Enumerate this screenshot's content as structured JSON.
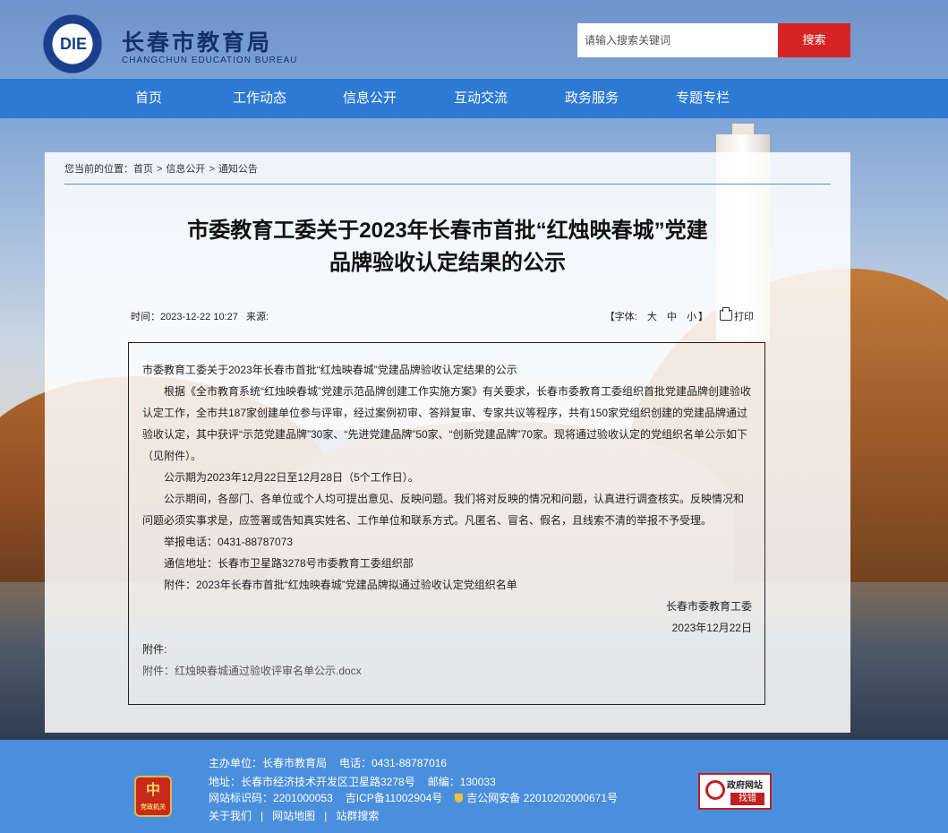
{
  "header": {
    "logo_mark": "DIE",
    "site_name": "长春市教育局",
    "site_name_en": "CHANGCHUN EDUCATION BUREAU",
    "search_placeholder": "请输入搜索关键词",
    "search_button": "搜索"
  },
  "nav": {
    "items": [
      "首页",
      "工作动态",
      "信息公开",
      "互动交流",
      "政务服务",
      "专题专栏"
    ]
  },
  "breadcrumb": {
    "prefix": "您当前的位置：",
    "items": [
      "首页",
      "信息公开",
      "通知公告"
    ],
    "separator": ">"
  },
  "article": {
    "title_line1": "市委教育工委关于2023年长春市首批“红烛映春城”党建",
    "title_line2": "品牌验收认定结果的公示",
    "time_label": "时间：",
    "time": "2023-12-22 10:27",
    "source_label": "来源:",
    "font_label": "【字体:",
    "font_large": "大",
    "font_medium": "中",
    "font_small": "小",
    "font_end": "】",
    "print": "打印",
    "p1": "市委教育工委关于2023年长春市首批“红烛映春城”党建品牌验收认定结果的公示",
    "p2": "根据《全市教育系统“红烛映春城”党建示范品牌创建工作实施方案》有关要求，长春市委教育工委组织首批党建品牌创建验收认定工作，全市共187家创建单位参与评审，经过案例初审、答辩复审、专家共议等程序，共有150家党组织创建的党建品牌通过验收认定，其中获评“示范党建品牌”30家、“先进党建品牌”50家、“创新党建品牌”70家。现将通过验收认定的党组织名单公示如下（见附件）。",
    "p3": "公示期为2023年12月22日至12月28日（5个工作日）。",
    "p4": "公示期间，各部门、各单位或个人均可提出意见、反映问题。我们将对反映的情况和问题，认真进行调查核实。反映情况和问题必须实事求是，应签署或告知真实姓名、工作单位和联系方式。凡匿名、冒名、假名，且线索不清的举报不予受理。",
    "p5": "举报电话：0431-88787073",
    "p6": "通信地址：长春市卫星路3278号市委教育工委组织部",
    "p7": "附件：2023年长春市首批“红烛映春城”党建品牌拟通过验收认定党组织名单",
    "signer": "长春市委教育工委",
    "sign_date": "2023年12月22日",
    "attach_label": "附件:",
    "attach_file": "附件：红烛映春城通过验收评审名单公示.docx"
  },
  "footer": {
    "sponsor": "主办单位：长春市教育局",
    "phone": "电话：0431-88787016",
    "address": "地址：长春市经济技术开发区卫星路3278号",
    "postcode": "邮编：130033",
    "site_code": "网站标识码：2201000053",
    "icp": "吉ICP备11002904号",
    "police": "吉公网安备 22010202000671号",
    "link_about": "关于我们",
    "link_map": "网站地图",
    "link_search": "站群搜索",
    "link_sep": "|",
    "party_char": "中",
    "party_label": "党政机关",
    "gov_badge_title": "政府网站",
    "gov_badge_action": "找错"
  }
}
